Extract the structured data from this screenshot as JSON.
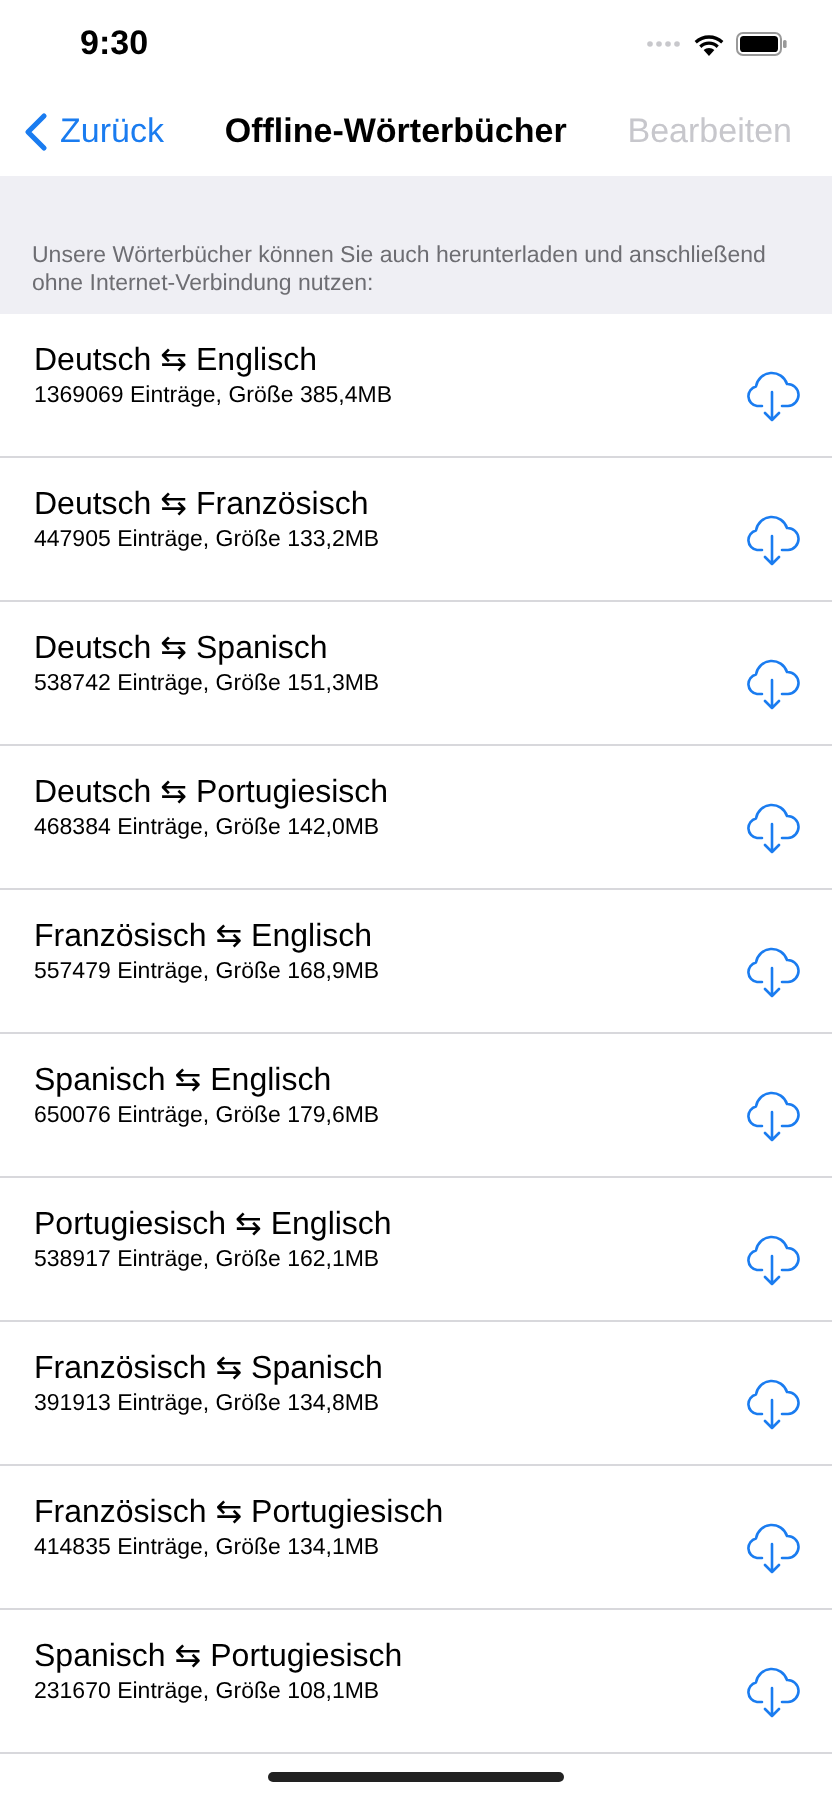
{
  "status_bar": {
    "time": "9:30"
  },
  "nav": {
    "back": "Zurück",
    "title": "Offline-Wörterbücher",
    "edit": {
      "label": "Bearbeiten",
      "disabled": true
    }
  },
  "section_header": "Unsere Wörterbücher können Sie auch herunterladen und anschließend ohne Internet-Verbindung nutzen:",
  "dictionaries": [
    {
      "title": "Deutsch ⇆ Englisch",
      "detail": "1369069 Einträge, Größe 385,4MB"
    },
    {
      "title": "Deutsch ⇆ Französisch",
      "detail": "447905 Einträge, Größe 133,2MB"
    },
    {
      "title": "Deutsch ⇆ Spanisch",
      "detail": "538742 Einträge, Größe 151,3MB"
    },
    {
      "title": "Deutsch ⇆ Portugiesisch",
      "detail": "468384 Einträge, Größe 142,0MB"
    },
    {
      "title": "Französisch ⇆ Englisch",
      "detail": "557479 Einträge, Größe 168,9MB"
    },
    {
      "title": "Spanisch ⇆ Englisch",
      "detail": "650076 Einträge, Größe 179,6MB"
    },
    {
      "title": "Portugiesisch ⇆ Englisch",
      "detail": "538917 Einträge, Größe 162,1MB"
    },
    {
      "title": "Französisch ⇆ Spanisch",
      "detail": "391913 Einträge, Größe 134,8MB"
    },
    {
      "title": "Französisch ⇆ Portugiesisch",
      "detail": "414835 Einträge, Größe 134,1MB"
    },
    {
      "title": "Spanisch ⇆ Portugiesisch",
      "detail": "231670 Einträge, Größe 108,1MB"
    }
  ]
}
